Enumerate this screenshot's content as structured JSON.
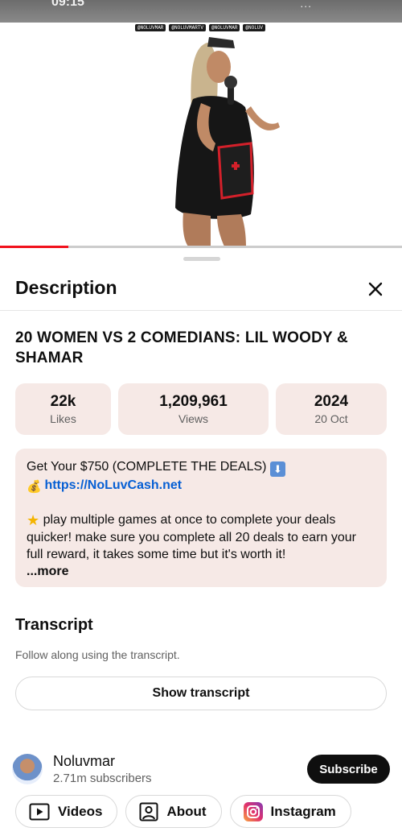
{
  "status_bar": {
    "time": "09:15",
    "signal": "..."
  },
  "video": {
    "watermark_tags": [
      "@NOLUVMAR",
      "@NOLUVMARTV",
      "@NOLUVMAR",
      "@NOLUV"
    ],
    "progress_fraction": 0.17
  },
  "sheet": {
    "title": "Description",
    "video_title": "20 WOMEN VS 2 COMEDIANS: LIL WOODY & SHAMAR",
    "stats": [
      {
        "value": "22k",
        "label": "Likes"
      },
      {
        "value": "1,209,961",
        "label": "Views"
      },
      {
        "value": "2024",
        "label": "20 Oct"
      }
    ],
    "description": {
      "line1": "Get Your $750 (COMPLETE THE DEALS)",
      "link": "https://NoLuvCash.net",
      "paragraph": "play multiple games at once to complete your deals quicker! make sure you complete all 20 deals to earn your full reward, it takes some time but it's worth it!",
      "more": "...more"
    },
    "transcript": {
      "title": "Transcript",
      "subtitle": "Follow along using the transcript.",
      "button": "Show transcript"
    },
    "channel": {
      "name": "Noluvmar",
      "subscribers": "2.71m subscribers",
      "subscribe_label": "Subscribe"
    },
    "chips": [
      {
        "label": "Videos",
        "icon": "play-box-icon"
      },
      {
        "label": "About",
        "icon": "person-box-icon"
      },
      {
        "label": "Instagram",
        "icon": "instagram-icon"
      }
    ]
  },
  "colors": {
    "pink_card": "#f6e9e6",
    "link": "#065fd4",
    "progress": "#f1111c",
    "subscribe_bg": "#0f0f0f"
  }
}
